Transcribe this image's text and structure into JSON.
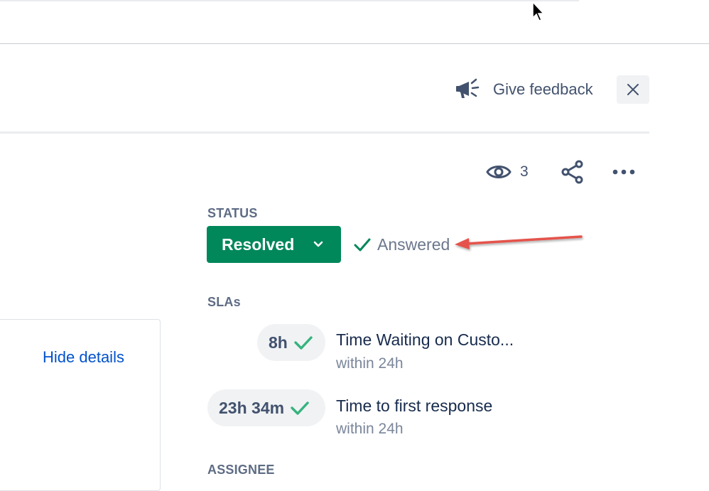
{
  "header": {
    "feedback_label": "Give feedback"
  },
  "actions": {
    "watchers_count": "3"
  },
  "status": {
    "label": "STATUS",
    "value": "Resolved",
    "resolution": "Answered"
  },
  "slas": {
    "label": "SLAs",
    "items": [
      {
        "time": "8h",
        "name": "Time Waiting on Custo...",
        "goal": "within 24h"
      },
      {
        "time": "23h 34m",
        "name": "Time to first response",
        "goal": "within 24h"
      }
    ]
  },
  "assignee": {
    "label": "ASSIGNEE"
  },
  "left_panel": {
    "hide_details": "Hide details"
  },
  "colors": {
    "status_green": "#00875a",
    "check_green": "#36b37e",
    "link_blue": "#0052cc",
    "annotation_arrow": "#e5534b"
  }
}
